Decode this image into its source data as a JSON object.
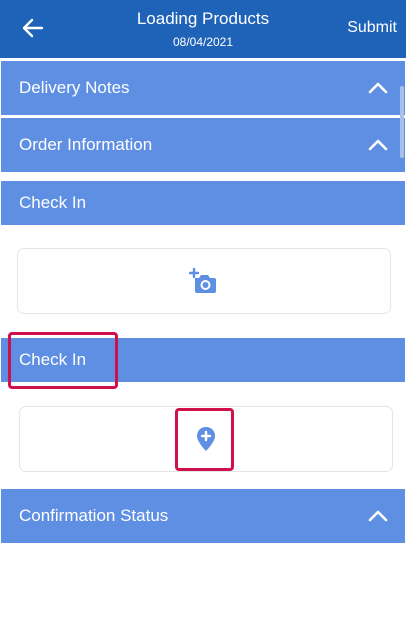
{
  "header": {
    "title": "Loading Products",
    "date": "08/04/2021",
    "submit_label": "Submit",
    "back_icon": "arrow-left-icon"
  },
  "sections": {
    "delivery_notes": {
      "label": "Delivery Notes",
      "icon": "chevron-up-icon"
    },
    "order_information": {
      "label": "Order Information",
      "icon": "chevron-up-icon"
    },
    "check_in_photo": {
      "label": "Check In",
      "icon": "add-photo-icon"
    },
    "check_in_location": {
      "label": "Check In",
      "icon": "add-location-icon"
    },
    "confirmation_status": {
      "label": "Confirmation Status",
      "icon": "chevron-up-icon"
    }
  },
  "colors": {
    "header": "#1f63b8",
    "section_bar": "#5e8fe3",
    "icon_accent": "#5e8fe3",
    "highlight": "#d0104a"
  }
}
